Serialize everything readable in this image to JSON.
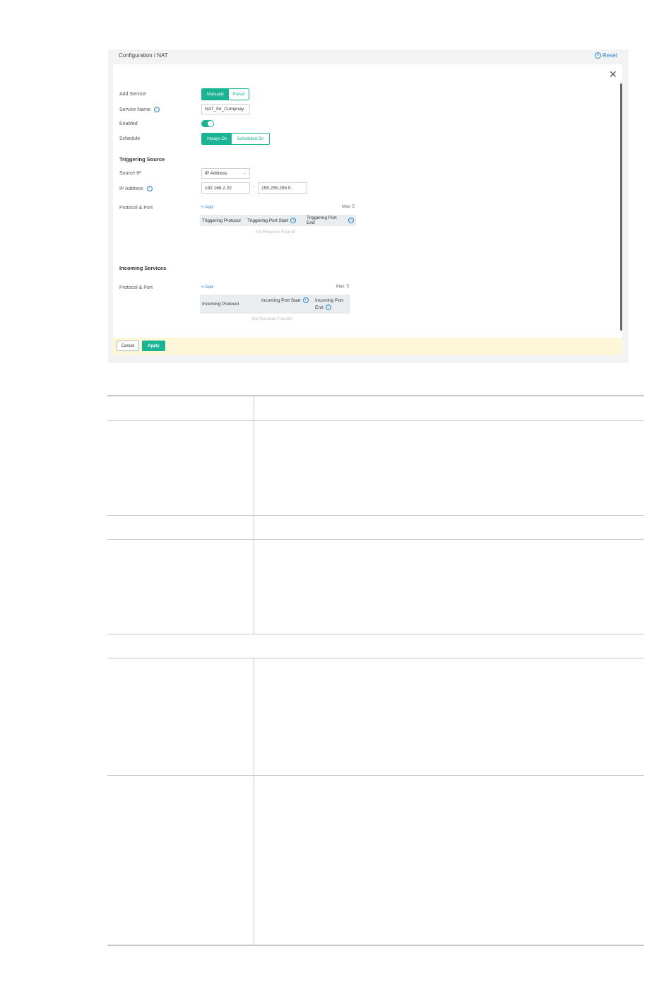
{
  "breadcrumb": "Configuration / NAT",
  "reset_label": "Reset",
  "form": {
    "add_service": {
      "label": "Add Service",
      "options": [
        "Manually",
        "Preset"
      ],
      "selected": "Manually"
    },
    "service_name": {
      "label": "Service Name",
      "value": "NAT_for_Compnay"
    },
    "enabled": {
      "label": "Enabled",
      "state": true
    },
    "schedule": {
      "label": "Schedule",
      "options": [
        "Always On",
        "Scheduled On"
      ],
      "selected": "Always On"
    }
  },
  "triggering": {
    "title": "Triggering Source",
    "source_ip": {
      "label": "Source IP",
      "value": "IP Address"
    },
    "ip_address": {
      "label": "IP Address",
      "ip": "192.168.2.22",
      "separator": "-",
      "mask": "255.255.255.0"
    },
    "protocol_port": {
      "label": "Protocol & Port",
      "add": "+ Add",
      "max": "Max: 5",
      "columns": [
        "Triggering Protocol",
        "Triggering Port Start",
        "Triggering Port End"
      ],
      "empty": "No Records Found!"
    }
  },
  "incoming": {
    "title": "Incoming Services",
    "protocol_port": {
      "label": "Protocol & Port",
      "add": "+ Add",
      "max": "Max: 5",
      "columns": [
        "Incoming Protocol",
        "Incoming Port Start",
        "Incoming Port End"
      ],
      "empty": "No Records Found!"
    }
  },
  "footer": {
    "cancel": "Cancel",
    "apply": "Apply"
  },
  "colors": {
    "accent": "#1ab394",
    "link": "#2b84c6",
    "footer_bg": "#fdf6d8"
  }
}
